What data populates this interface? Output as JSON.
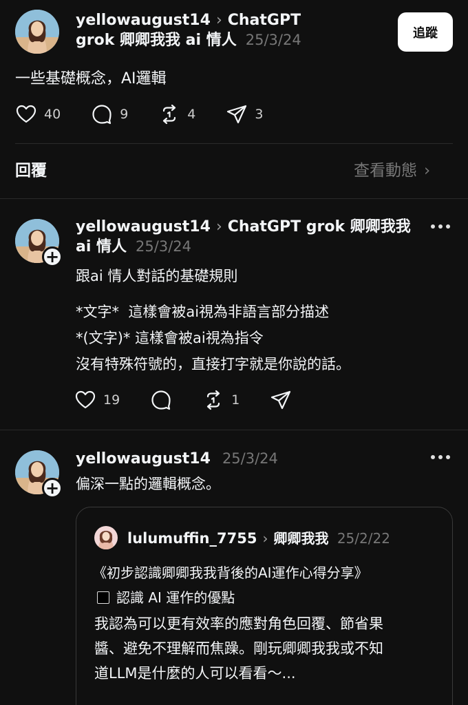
{
  "top_post": {
    "username": "yellowaugust14",
    "topic_line1": "ChatGPT",
    "topic_line2": "grok 卿卿我我 ai 情人",
    "date": "25/3/24",
    "follow_label": "追蹤",
    "body": "一些基礎概念，AI邏輯",
    "likes": "40",
    "comments": "9",
    "reposts": "4",
    "shares": "3"
  },
  "replies_bar": {
    "title": "回覆",
    "view_activity": "查看動態"
  },
  "reply1": {
    "username": "yellowaugust14",
    "topic": "ChatGPT grok 卿卿我我",
    "topic_cont": "ai 情人",
    "date": "25/3/24",
    "lines": [
      "跟ai 情人對話的基礎規則",
      "*文字*  這樣會被ai視為非語言部分描述",
      "*(文字)* 這樣會被ai視為指令",
      "沒有特殊符號的，直接打字就是你說的話。"
    ],
    "likes": "19",
    "reposts": "1"
  },
  "reply2": {
    "username": "yellowaugust14",
    "date": "25/3/24",
    "body": "偏深一點的邏輯概念。",
    "quote": {
      "username": "lulumuffin_7755",
      "topic": "卿卿我我",
      "date": "25/2/22",
      "title": "《初步認識卿卿我我背後的AI運作心得分享》",
      "subtitle": "認識 AI 運作的優點",
      "text_lines": [
        "我認為可以更有效率的應對角色回覆、節省果",
        "醬、避免不理解而焦躁。剛玩卿卿我我或不知",
        "道LLM是什麼的人可以看看～..."
      ]
    }
  },
  "colors": {
    "background": "#101010",
    "text": "#f3f5f7",
    "muted": "#777777",
    "divider": "#2a2a2a"
  }
}
